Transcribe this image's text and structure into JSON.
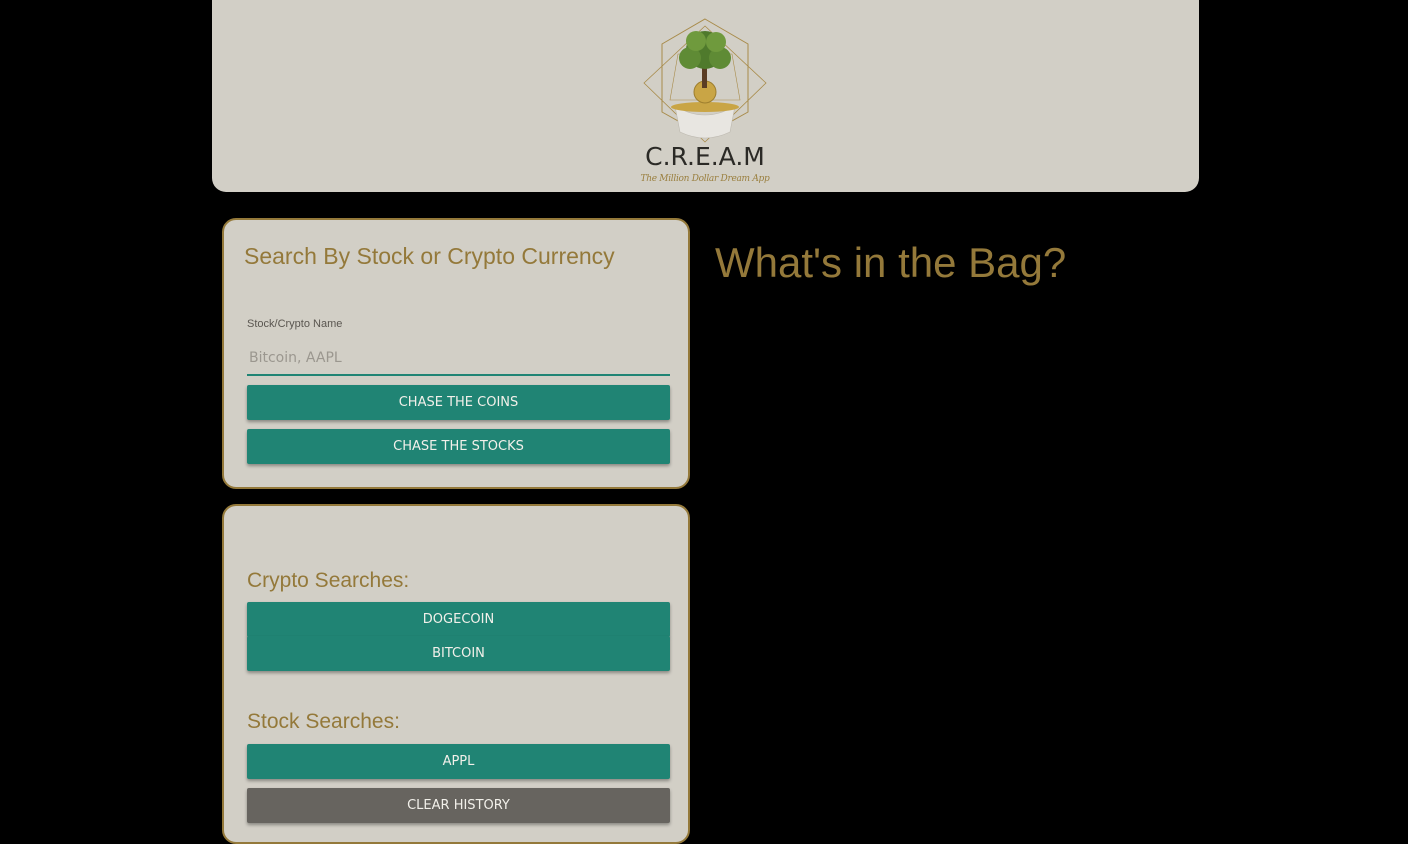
{
  "header": {
    "logo_title": "C.R.E.A.M",
    "logo_tagline": "The Million Dollar Dream App"
  },
  "search_card": {
    "title": "Search By Stock or Crypto Currency",
    "input_label": "Stock/Crypto Name",
    "input_value": "",
    "input_placeholder": "Bitcoin, AAPL",
    "coins_button": "CHASE THE COINS",
    "stocks_button": "CHASE THE STOCKS"
  },
  "history_card": {
    "crypto_title": "Crypto Searches:",
    "crypto_items": [
      "DOGECOIN",
      "BITCOIN"
    ],
    "stock_title": "Stock Searches:",
    "stock_items": [
      "APPL"
    ],
    "clear_button": "CLEAR HISTORY"
  },
  "results": {
    "title": "What's in the Bag?"
  },
  "colors": {
    "background": "#000000",
    "panel": "#d2cfc6",
    "gold": "#94793a",
    "teal": "#208474",
    "gray_button": "#67645f"
  }
}
